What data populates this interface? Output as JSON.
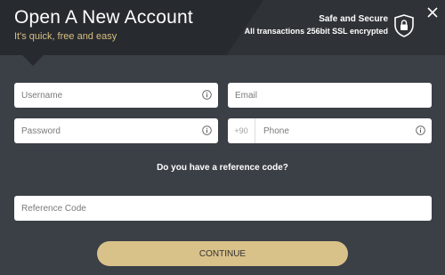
{
  "header": {
    "title": "Open A New Account",
    "subtitle": "It's quick, free and easy",
    "secure_title": "Safe and Secure",
    "secure_subtitle": "All transactions 256bit SSL encrypted"
  },
  "form": {
    "username": {
      "placeholder": "Username",
      "value": ""
    },
    "email": {
      "placeholder": "Email",
      "value": ""
    },
    "password": {
      "placeholder": "Password",
      "value": ""
    },
    "phone": {
      "prefix": "+90",
      "placeholder": "Phone",
      "value": ""
    },
    "reference_question": "Do you have a reference code?",
    "reference_code": {
      "placeholder": "Reference Code",
      "value": ""
    },
    "continue_label": "CONTINUE"
  },
  "colors": {
    "accent": "#d9c28a",
    "subtitle": "#d8bf80",
    "background": "#3b3f46",
    "header_dark": "#272a2f"
  },
  "icons": {
    "close": "close-icon",
    "shield": "shield-lock-icon",
    "info": "info-icon"
  }
}
